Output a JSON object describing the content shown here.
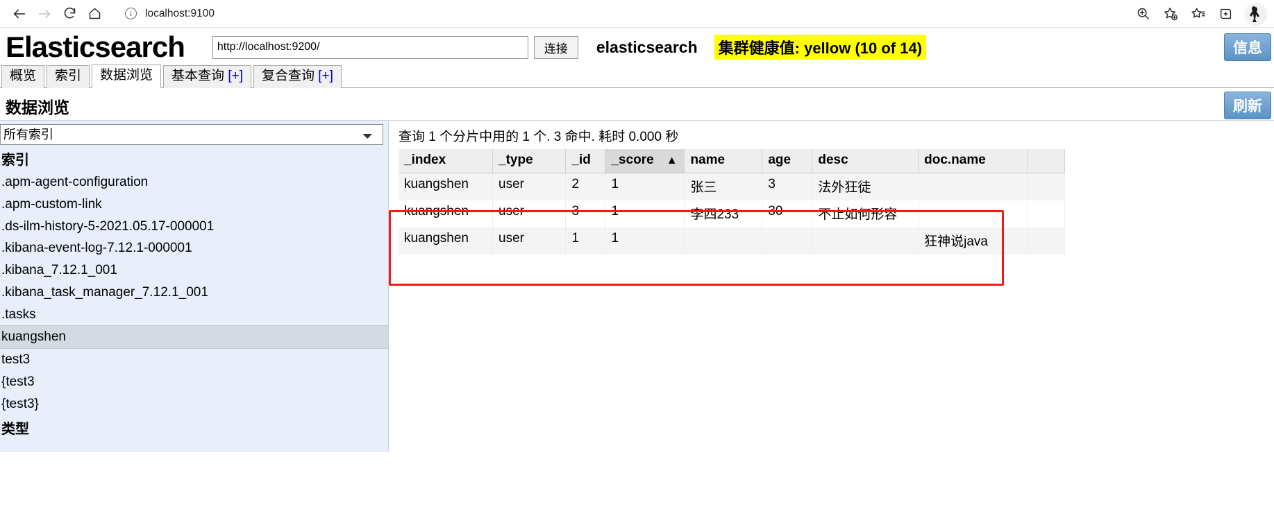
{
  "browser": {
    "url": "localhost:9100",
    "back_icon": "back-arrow-icon",
    "forward_icon": "forward-arrow-icon",
    "reload_icon": "reload-icon",
    "home_icon": "home-icon",
    "site_info_icon": "info-circle-icon",
    "zoom_icon": "zoom-in-icon",
    "favorite_icon": "add-favorite-star-icon",
    "favorites_list_icon": "favorites-list-icon",
    "collections_icon": "collections-icon",
    "profile_icon": "profile-avatar-icon"
  },
  "app": {
    "logo": "Elasticsearch",
    "server_url": "http://localhost:9200/",
    "server_url_placeholder": "http://localhost:9200/",
    "connect_label": "连接",
    "cluster_name": "elasticsearch",
    "health_text": "集群健康值: yellow (10 of 14)",
    "health_color": "#ffff00",
    "info_label": "信息",
    "refresh_label": "刷新"
  },
  "tabs": [
    {
      "label": "概览",
      "suffix": "",
      "active": false
    },
    {
      "label": "索引",
      "suffix": "",
      "active": false
    },
    {
      "label": "数据浏览",
      "suffix": "",
      "active": true
    },
    {
      "label": "基本查询 ",
      "suffix": "[+]",
      "active": false
    },
    {
      "label": "复合查询 ",
      "suffix": "[+]",
      "active": false
    }
  ],
  "page": {
    "title": "数据浏览"
  },
  "sidebar": {
    "index_filter_value": "所有索引",
    "index_filter_options": [
      "所有索引"
    ],
    "index_heading": "索引",
    "indices": [
      {
        "label": ".apm-agent-configuration",
        "selected": false
      },
      {
        "label": ".apm-custom-link",
        "selected": false
      },
      {
        "label": ".ds-ilm-history-5-2021.05.17-000001",
        "selected": false
      },
      {
        "label": ".kibana-event-log-7.12.1-000001",
        "selected": false
      },
      {
        "label": ".kibana_7.12.1_001",
        "selected": false
      },
      {
        "label": ".kibana_task_manager_7.12.1_001",
        "selected": false
      },
      {
        "label": ".tasks",
        "selected": false
      },
      {
        "label": "kuangshen",
        "selected": true
      },
      {
        "label": "test3",
        "selected": false
      },
      {
        "label": "{test3",
        "selected": false
      },
      {
        "label": "{test3}",
        "selected": false
      }
    ],
    "type_heading": "类型"
  },
  "results": {
    "summary": "查询 1 个分片中用的 1 个. 3 命中. 耗时 0.000 秒",
    "columns": [
      {
        "key": "_index",
        "label": "_index",
        "sorted": false
      },
      {
        "key": "_type",
        "label": "_type",
        "sorted": false
      },
      {
        "key": "_id",
        "label": "_id",
        "sorted": false
      },
      {
        "key": "_score",
        "label": "_score",
        "sorted": true,
        "sort_arrow": "▲"
      },
      {
        "key": "name",
        "label": "name",
        "sorted": false
      },
      {
        "key": "age",
        "label": "age",
        "sorted": false
      },
      {
        "key": "desc",
        "label": "desc",
        "sorted": false
      },
      {
        "key": "doc.name",
        "label": "doc.name",
        "sorted": false
      },
      {
        "key": "pad",
        "label": "",
        "sorted": false
      }
    ],
    "rows": [
      {
        "_index": "kuangshen",
        "_type": "user",
        "_id": "2",
        "_score": "1",
        "name": "张三",
        "age": "3",
        "desc": "法外狂徒",
        "doc.name": "",
        "pad": ""
      },
      {
        "_index": "kuangshen",
        "_type": "user",
        "_id": "3",
        "_score": "1",
        "name": "李四233",
        "age": "30",
        "desc": "不止如何形容",
        "doc.name": "",
        "pad": ""
      },
      {
        "_index": "kuangshen",
        "_type": "user",
        "_id": "1",
        "_score": "1",
        "name": "",
        "age": "",
        "desc": "",
        "doc.name": "狂神说java",
        "pad": ""
      }
    ],
    "annotation_color": "#ee1c11"
  }
}
